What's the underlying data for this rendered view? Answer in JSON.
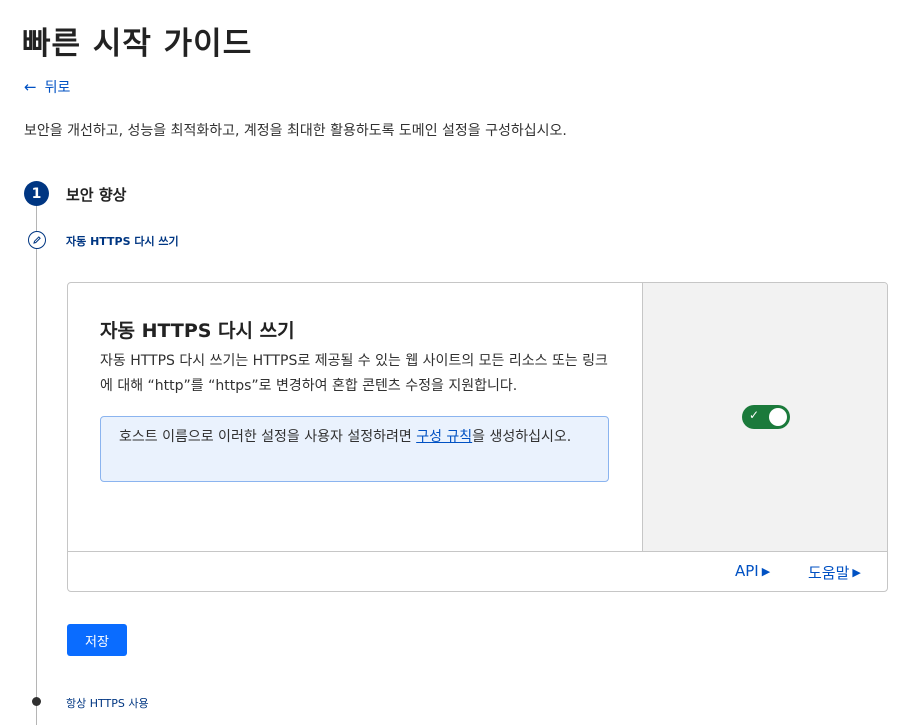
{
  "page": {
    "title": "빠른 시작 가이드",
    "back_label": "뒤로",
    "description": "보안을 개선하고, 성능을 최적화하고, 계정을 최대한 활용하도록 도메인 설정을 구성하십시오."
  },
  "steps": {
    "step1_number": "1",
    "step1_label": "보안 향상",
    "sub_current_label": "자동 HTTPS 다시 쓰기",
    "sub_next_label": "항상 HTTPS 사용"
  },
  "card": {
    "title": "자동 HTTPS 다시 쓰기",
    "body": "자동 HTTPS 다시 쓰기는 HTTPS로 제공될 수 있는 웹 사이트의 모든 리소스 또는 링크에 대해 “http”를 “https”로 변경하여 혼합 콘텐츠 수정을 지원합니다.",
    "info_prefix": "호스트 이름으로 이러한 설정을 사용자 설정하려면 ",
    "info_link": "구성 규칙",
    "info_suffix": "을 생성하십시오.",
    "toggle_on": true,
    "footer_api": "API",
    "footer_help": "도움말"
  },
  "actions": {
    "save_label": "저장"
  },
  "colors": {
    "accent": "#0a6cff",
    "link": "#0051c3",
    "step_navy": "#003682",
    "toggle_green": "#1b7a3b"
  }
}
